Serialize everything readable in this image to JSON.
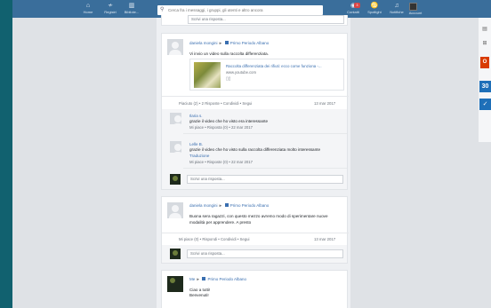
{
  "topbar": {
    "nav": [
      {
        "label": "Home",
        "icon": "home-icon",
        "glyph": "⌂"
      },
      {
        "label": "Registri",
        "icon": "pulse-icon",
        "glyph": "≁"
      },
      {
        "label": "Bibliote...",
        "icon": "library-icon",
        "glyph": "▥"
      }
    ],
    "search_placeholder": "Cerca fra i messaggi, i gruppi, gli utenti e altro ancora",
    "right_nav": [
      {
        "label": "Contatti",
        "icon": "contacts-icon",
        "glyph": "◉"
      },
      {
        "label": "Spotlight",
        "icon": "spotlight-icon",
        "glyph": "♋"
      },
      {
        "label": "Notifiche",
        "icon": "bell-icon",
        "glyph": "♫"
      },
      {
        "label": "Account",
        "icon": "account-icon",
        "glyph": ""
      }
    ],
    "contacts_badge": "3"
  },
  "colors": {
    "topbar": "#3a6e9b",
    "link": "#3a6fb0",
    "side_band": "#11616f"
  },
  "top_reply": {
    "placeholder": "Scrivi una risposta..."
  },
  "posts": [
    {
      "author": "daniela mongini",
      "group": "Primo Periodo Albano",
      "text": "Vi invio un video sulla raccolta differenziata.",
      "link": {
        "title": "Raccolta differenziata dei rifiuti: ecco come funziona -...",
        "url": "www.youtube.com"
      },
      "actions": "Piaciuto (2)  •  2 Risposte  •  Condividi  •  Segui",
      "date": "13 mar 2017",
      "replies": [
        {
          "author": "Ilaria s.",
          "text": "grazie il video che ho visto era interessante",
          "meta": "Mi piace  •  Risposta (0)  •  22 mar 2017"
        },
        {
          "author": "Lelle B.",
          "text": "grazie il video che ho visto sulla raccolta differenziata molto interessante",
          "translate": "Traduzione",
          "meta": "Mi piace  •  Risposte (0)  •  22 mar 2017"
        }
      ],
      "reply_placeholder": "Scrivi una risposta..."
    },
    {
      "author": "daniela mongini",
      "group": "Primo Periodo Albano",
      "text": "Buona sera ragazzi, con questo mezzo avremo modo di sperimentare nuove modalità per apprendere. A presto",
      "actions": "Mi piace (0)  •  Rispondi  •  Condividi  •  Segui",
      "date": "13 mar 2017",
      "reply_placeholder": "Scrivi una risposta..."
    },
    {
      "author": "Me",
      "group": "Primo Periodo Albano",
      "text_lines": [
        "Ciao a tutti!",
        "Benvenuti!"
      ]
    }
  ],
  "right_rail": {
    "icons": [
      "calendar-icon",
      "grid-icon",
      "office-icon",
      "calendar-30-icon",
      "tasks-icon"
    ],
    "calendar_day": "30"
  }
}
